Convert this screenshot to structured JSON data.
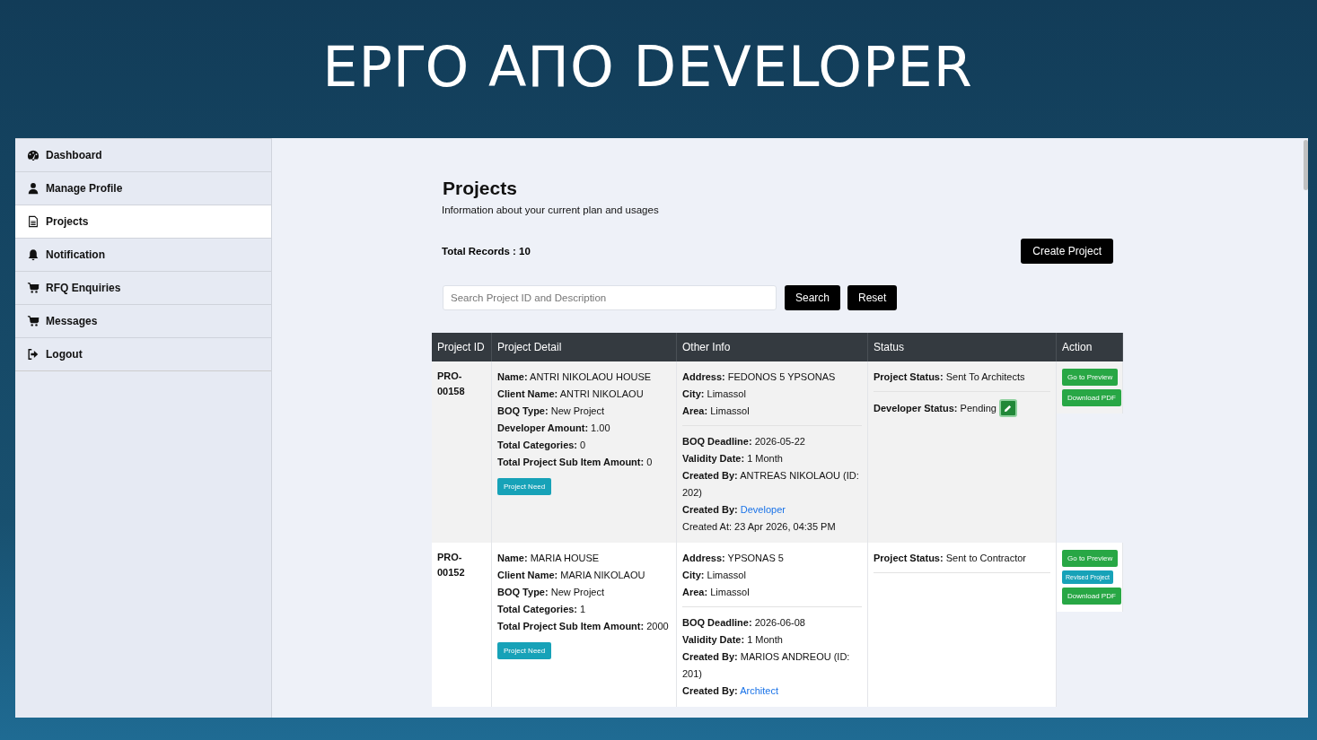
{
  "slide_title": "ΕΡΓΟ ΑΠΟ DEVELOPER",
  "sidebar": {
    "items": [
      {
        "label": "Dashboard",
        "selected": false
      },
      {
        "label": "Manage Profile",
        "selected": false
      },
      {
        "label": "Projects",
        "selected": true
      },
      {
        "label": "Notification",
        "selected": false
      },
      {
        "label": "RFQ Enquiries",
        "selected": false
      },
      {
        "label": "Messages",
        "selected": false
      },
      {
        "label": "Logout",
        "selected": false
      }
    ]
  },
  "page": {
    "title": "Projects",
    "subtitle": "Information about your current plan and usages",
    "total_records": {
      "label": "Total Records :",
      "value": "10"
    },
    "create_button": "Create Project",
    "search": {
      "placeholder": "Search Project ID and Description",
      "search_button": "Search",
      "reset_button": "Reset"
    }
  },
  "table": {
    "columns": [
      "Project ID",
      "Project Detail",
      "Other Info",
      "Status",
      "Action"
    ],
    "rows": [
      {
        "id": "PRO-00158",
        "detail": [
          {
            "label": "Name:",
            "value": "ANTRI NIKOLAOU HOUSE"
          },
          {
            "label": "Client Name:",
            "value": "ANTRI NIKOLAOU"
          },
          {
            "label": "BOQ Type:",
            "value": "New Project"
          },
          {
            "label": "Developer Amount:",
            "value": "1.00"
          },
          {
            "label": "Total Categories:",
            "value": "0"
          },
          {
            "label": "Total Project Sub Item Amount:",
            "value": "0"
          }
        ],
        "need_button": "Project Need",
        "location": [
          {
            "label": "Address:",
            "value": "FEDONOS 5 YPSONAS"
          },
          {
            "label": "City:",
            "value": "Limassol"
          },
          {
            "label": "Area:",
            "value": "Limassol"
          }
        ],
        "dates": [
          {
            "kind": "field",
            "label": "BOQ Deadline:",
            "value": "2026-05-22"
          },
          {
            "kind": "field",
            "label": "Validity Date:",
            "value": "1 Month"
          },
          {
            "kind": "field",
            "label": "Created By:",
            "value": "ANTREAS NIKOLAOU (ID: 202)"
          },
          {
            "kind": "link",
            "label": "Created By:",
            "value": "Developer"
          },
          {
            "kind": "plain",
            "value": "Created At: 23 Apr 2026, 04:35 PM"
          }
        ],
        "project_status": {
          "label": "Project Status:",
          "value": "Sent To Architects"
        },
        "developer_status": {
          "label": "Developer Status:",
          "value": "Pending"
        },
        "actions": [
          {
            "kind": "success",
            "label": "Go to Preview"
          },
          {
            "kind": "success",
            "label": "Download PDF"
          }
        ]
      },
      {
        "id": "PRO-00152",
        "detail": [
          {
            "label": "Name:",
            "value": "MARIA HOUSE"
          },
          {
            "label": "Client Name:",
            "value": "MARIA NIKOLAOU"
          },
          {
            "label": "BOQ Type:",
            "value": "New Project"
          },
          {
            "label": "Total Categories:",
            "value": "1"
          },
          {
            "label": "Total Project Sub Item Amount:",
            "value": "2000"
          }
        ],
        "need_button": "Project Need",
        "location": [
          {
            "label": "Address:",
            "value": "YPSONAS 5"
          },
          {
            "label": "City:",
            "value": "Limassol"
          },
          {
            "label": "Area:",
            "value": "Limassol"
          }
        ],
        "dates": [
          {
            "kind": "field",
            "label": "BOQ Deadline:",
            "value": "2026-06-08"
          },
          {
            "kind": "field",
            "label": "Validity Date:",
            "value": "1 Month"
          },
          {
            "kind": "field",
            "label": "Created By:",
            "value": "MARIOS ANDREOU (ID: 201)"
          },
          {
            "kind": "link",
            "label": "Created By:",
            "value": "Architect"
          }
        ],
        "project_status": {
          "label": "Project Status:",
          "value": "Sent to Contractor"
        },
        "actions": [
          {
            "kind": "success",
            "label": "Go to Preview"
          },
          {
            "kind": "info",
            "label": "Revised Project"
          },
          {
            "kind": "success",
            "label": "Download PDF"
          }
        ]
      }
    ]
  }
}
